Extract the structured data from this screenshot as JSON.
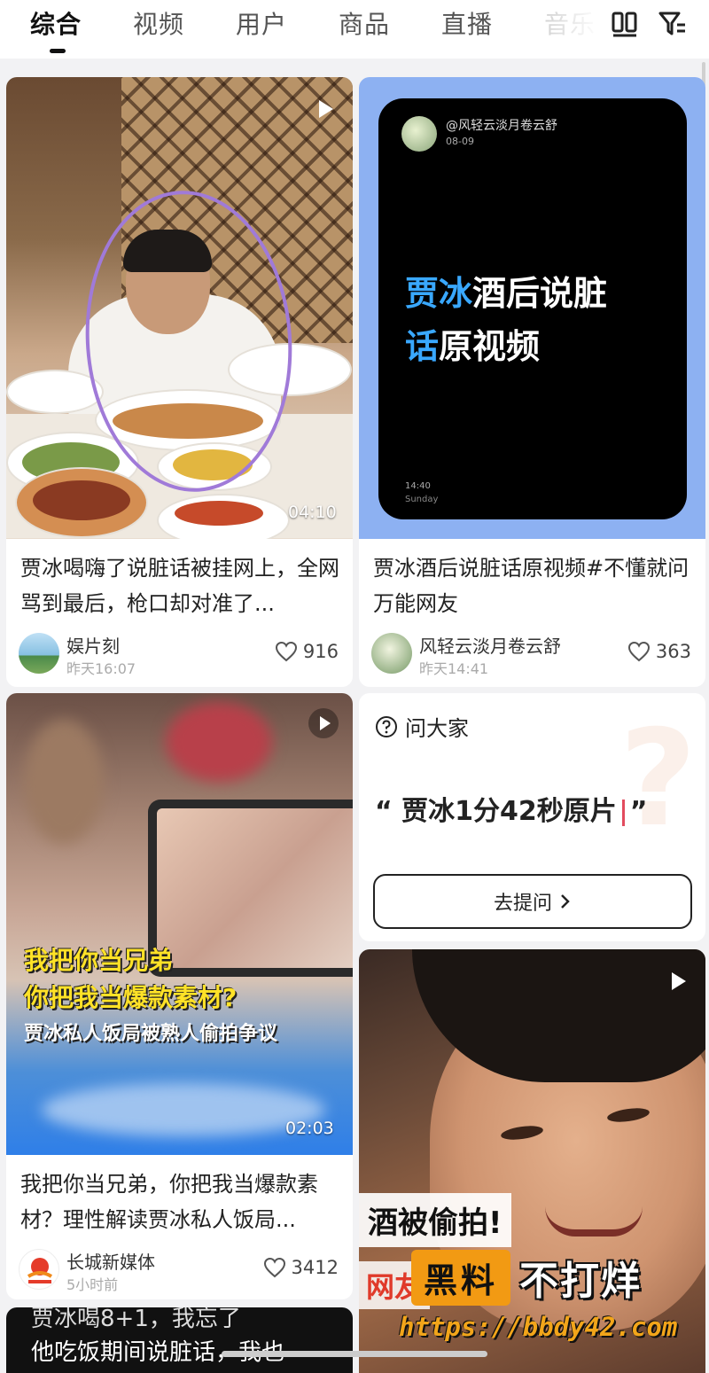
{
  "tabs": [
    {
      "label": "综合",
      "active": true
    },
    {
      "label": "视频"
    },
    {
      "label": "用户"
    },
    {
      "label": "商品"
    },
    {
      "label": "直播"
    },
    {
      "label": "音乐"
    }
  ],
  "toolbar": {
    "layout_icon": "grid-toggle-icon",
    "filter_icon": "filter-icon"
  },
  "cards": {
    "c1": {
      "duration": "04:10",
      "title": "贾冰喝嗨了说脏话被挂网上，全网骂到最后，枪口却对准了...",
      "author": "娱片刻",
      "time": "昨天16:07",
      "likes": "916"
    },
    "c2": {
      "post_handle": "@风轻云淡月卷云舒",
      "post_date": "08-09",
      "post_text_highlight": "贾冰",
      "post_text_rest1": "酒后说脏",
      "post_text_highlight2": "话",
      "post_text_rest2": "原视频",
      "post_clock": "14:40",
      "post_day": "Sunday",
      "title": "贾冰酒后说脏话原视频#不懂就问万能网友",
      "author": "风轻云淡月卷云舒",
      "time": "昨天14:41",
      "likes": "363"
    },
    "c3": {
      "overlay1": "我把你当兄弟",
      "overlay2": "你把我当爆款素材?",
      "overlay3": "贾冰私人饭局被熟人偷拍争议",
      "duration": "02:03",
      "title": "我把你当兄弟，你把我当爆款素材？理性解读贾冰私人饭局...",
      "author": "长城新媒体",
      "time": "5小时前",
      "likes": "3412"
    },
    "ask": {
      "header": "问大家",
      "quote_open": "“",
      "query": "贾冰1分42秒原片",
      "quote_close": "”",
      "button": "去提问"
    },
    "c5": {
      "sticker": "酒被偷拍!",
      "red_text": "网友"
    },
    "c6": {
      "line1": "贾冰喝8+1，我忘了",
      "line2": "他吃饭期间说脏话，我也"
    }
  },
  "watermark": {
    "badge": "黑料",
    "text": "不打烊",
    "url": "https://bbdy42.com"
  },
  "colors": {
    "accent_blue": "#8db1f2",
    "ask_caret": "#e24b5e",
    "watermark_orange": "#f29a13"
  }
}
